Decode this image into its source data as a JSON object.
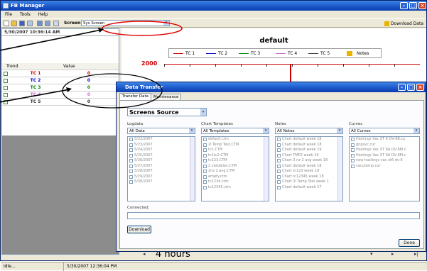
{
  "app": {
    "title": "FB Manager",
    "min": "–",
    "max": "□",
    "close": "×"
  },
  "menu": [
    "File",
    "Tools",
    "Help"
  ],
  "toolbar": {
    "screen_label": "Screen:",
    "screen_value": "Sys Screen",
    "download_label": "Download Data"
  },
  "left": {
    "datetime": "5/30/2007 10:36:14 AM",
    "col_trend": "Trend",
    "col_value": "Value",
    "rows": [
      {
        "name": "TC 1",
        "value": "0",
        "color": "#cc0000"
      },
      {
        "name": "TC 2",
        "value": "0",
        "color": "#0000cc"
      },
      {
        "name": "TC 3",
        "value": "0",
        "color": "#008800"
      },
      {
        "name": "TC 4",
        "value": "0",
        "color": "#cc66cc"
      },
      {
        "name": "TC 5",
        "value": "0",
        "color": "#333333"
      }
    ]
  },
  "chart": {
    "title": "default",
    "y_tick": "2000",
    "legend": [
      "TC 1",
      "TC 2",
      "TC 3",
      "TC 4",
      "TC 5",
      "Notes"
    ],
    "legend_colors": [
      "#cc0000",
      "#0000cc",
      "#008800",
      "#cc66cc",
      "#333333",
      "#e8b400"
    ],
    "span": "4 hours"
  },
  "status": {
    "left": "Idle...",
    "time": "5/30/2007 12:36:04 PM"
  },
  "dialog": {
    "title": "Data Transfer",
    "tabs": [
      "Transfer Data",
      "Maintenance"
    ],
    "source": "Screens Source",
    "logdata": {
      "label": "Logdata",
      "filter": "All Data",
      "items": [
        "5/22/2007",
        "5/23/2007",
        "5/24/2007",
        "5/25/2007",
        "5/26/2007",
        "5/27/2007",
        "5/28/2007",
        "5/29/2007",
        "5/30/2007"
      ]
    },
    "templates": {
      "label": "Chart Templates",
      "filter": "All Templates",
      "items": [
        "default.ctm",
        "2l Temp Test.CTM",
        "tc1.CTM",
        "tc1tc2.CTM",
        "tc123.CTM",
        "2 variables.CTM",
        "2nz 2 avg.CTM",
        "empty.ctm",
        "tc1234.ctm",
        "tc12345.ctm"
      ]
    },
    "notes": {
      "label": "Notes",
      "filter": "All Notes",
      "items": [
        "Chart default week 18",
        "Chart default week 18",
        "Chart default week 19",
        "Chart TMP2 week 19",
        "Chart 2 nz 2 avg week 18",
        "Chart default week 18",
        "Chart tc123 week 18",
        "Chart tc12345 week 18",
        "Chart 2l Temp Test week 1",
        "Chart default week 17"
      ]
    },
    "curves": {
      "label": "Curves",
      "filter": "All Curves",
      "items": [
        "Hastings Vac XT 6 DV-6B.cu",
        "gnpsvc.cur",
        "Hastings Vac XT 6A DV-6M.c",
        "Hastings Vac XT 6A DV-6M.c",
        "new hastings vac xt6 dv-6",
        "vacutemp.cur"
      ]
    },
    "connected": "Connected.",
    "download": "Download",
    "done": "Done"
  }
}
